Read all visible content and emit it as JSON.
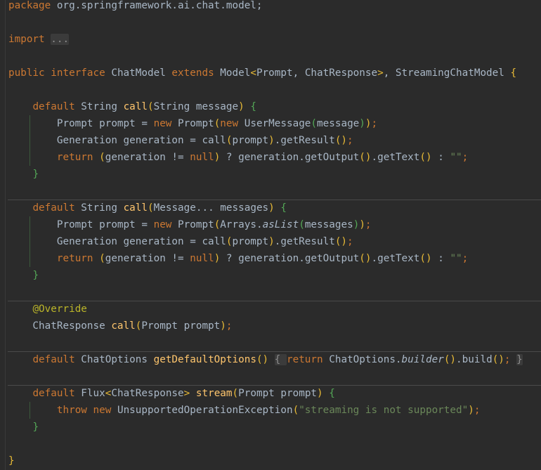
{
  "editor": {
    "theme_colors": {
      "background": "#2b2b2b",
      "keyword": "#cc7832",
      "text": "#a9b7c6",
      "method": "#ffc66d",
      "string": "#6a8759",
      "annotation": "#bbb529",
      "bracket_level1": "#e8ba36",
      "bracket_level2": "#54a857"
    }
  },
  "code": {
    "lines": [
      [
        [
          "package",
          "k"
        ],
        [
          " org.springframework.ai.chat.model;",
          ""
        ]
      ],
      [],
      [
        [
          "import",
          "k"
        ],
        [
          " ",
          ""
        ],
        [
          "...",
          "f"
        ]
      ],
      [],
      [
        [
          "public",
          "k"
        ],
        [
          " ",
          ""
        ],
        [
          "interface",
          "k"
        ],
        [
          " ChatModel ",
          ""
        ],
        [
          "extends",
          "k"
        ],
        [
          " Model",
          ""
        ],
        [
          "<",
          "p1"
        ],
        [
          "Prompt, ChatResponse",
          ""
        ],
        [
          ">",
          "p1"
        ],
        [
          ", StreamingChatModel ",
          ""
        ],
        [
          "{",
          "p1"
        ]
      ],
      [],
      [
        [
          "    ",
          ""
        ],
        [
          "default",
          "k"
        ],
        [
          " String ",
          ""
        ],
        [
          "call",
          "m"
        ],
        [
          "(",
          "p1"
        ],
        [
          "String message",
          ""
        ],
        [
          ")",
          "p1"
        ],
        [
          " ",
          ""
        ],
        [
          "{",
          "p2"
        ]
      ],
      [
        [
          "        Prompt prompt = ",
          ""
        ],
        [
          "new",
          "k"
        ],
        [
          " Prompt",
          ""
        ],
        [
          "(",
          "p1"
        ],
        [
          "new",
          "k"
        ],
        [
          " UserMessage",
          ""
        ],
        [
          "(",
          "p2"
        ],
        [
          "message",
          ""
        ],
        [
          ")",
          "p2"
        ],
        [
          ")",
          "p1"
        ],
        [
          ";",
          "k"
        ]
      ],
      [
        [
          "        Generation generation = call",
          ""
        ],
        [
          "(",
          "p1"
        ],
        [
          "prompt",
          ""
        ],
        [
          ")",
          "p1"
        ],
        [
          ".getResult",
          ""
        ],
        [
          "()",
          "p1"
        ],
        [
          ";",
          "k"
        ]
      ],
      [
        [
          "        ",
          ""
        ],
        [
          "return",
          "k"
        ],
        [
          " ",
          ""
        ],
        [
          "(",
          "p1"
        ],
        [
          "generation != ",
          ""
        ],
        [
          "null",
          "k"
        ],
        [
          ")",
          "p1"
        ],
        [
          " ? generation.getOutput",
          ""
        ],
        [
          "()",
          "p1"
        ],
        [
          ".getText",
          ""
        ],
        [
          "()",
          "p1"
        ],
        [
          " : ",
          ""
        ],
        [
          "\"\"",
          "s"
        ],
        [
          ";",
          "k"
        ]
      ],
      [
        [
          "    ",
          ""
        ],
        [
          "}",
          "p2"
        ]
      ],
      [],
      [
        [
          "    ",
          ""
        ],
        [
          "default",
          "k"
        ],
        [
          " String ",
          ""
        ],
        [
          "call",
          "m"
        ],
        [
          "(",
          "p1"
        ],
        [
          "Message... messages",
          ""
        ],
        [
          ")",
          "p1"
        ],
        [
          " ",
          ""
        ],
        [
          "{",
          "p2"
        ]
      ],
      [
        [
          "        Prompt prompt = ",
          ""
        ],
        [
          "new",
          "k"
        ],
        [
          " Prompt",
          ""
        ],
        [
          "(",
          "p1"
        ],
        [
          "Arrays.",
          ""
        ],
        [
          "asList",
          "i"
        ],
        [
          "(",
          "p2"
        ],
        [
          "messages",
          ""
        ],
        [
          ")",
          "p2"
        ],
        [
          ")",
          "p1"
        ],
        [
          ";",
          "k"
        ]
      ],
      [
        [
          "        Generation generation = call",
          ""
        ],
        [
          "(",
          "p1"
        ],
        [
          "prompt",
          ""
        ],
        [
          ")",
          "p1"
        ],
        [
          ".getResult",
          ""
        ],
        [
          "()",
          "p1"
        ],
        [
          ";",
          "k"
        ]
      ],
      [
        [
          "        ",
          ""
        ],
        [
          "return",
          "k"
        ],
        [
          " ",
          ""
        ],
        [
          "(",
          "p1"
        ],
        [
          "generation != ",
          ""
        ],
        [
          "null",
          "k"
        ],
        [
          ")",
          "p1"
        ],
        [
          " ? generation.getOutput",
          ""
        ],
        [
          "()",
          "p1"
        ],
        [
          ".getText",
          ""
        ],
        [
          "()",
          "p1"
        ],
        [
          " : ",
          ""
        ],
        [
          "\"\"",
          "s"
        ],
        [
          ";",
          "k"
        ]
      ],
      [
        [
          "    ",
          ""
        ],
        [
          "}",
          "p2"
        ]
      ],
      [],
      [
        [
          "    ",
          ""
        ],
        [
          "@Override",
          "a"
        ]
      ],
      [
        [
          "    ChatResponse ",
          ""
        ],
        [
          "call",
          "m"
        ],
        [
          "(",
          "p1"
        ],
        [
          "Prompt prompt",
          ""
        ],
        [
          ")",
          "p1"
        ],
        [
          ";",
          "k"
        ]
      ],
      [],
      [
        [
          "    ",
          ""
        ],
        [
          "default",
          "k"
        ],
        [
          " ChatOptions ",
          ""
        ],
        [
          "getDefaultOptions",
          "m"
        ],
        [
          "()",
          "p1"
        ],
        [
          " ",
          ""
        ],
        [
          "{ ",
          "f"
        ],
        [
          "return",
          "k"
        ],
        [
          " ChatOptions.",
          ""
        ],
        [
          "builder",
          "i"
        ],
        [
          "()",
          "p1"
        ],
        [
          ".build",
          ""
        ],
        [
          "()",
          "p1"
        ],
        [
          ";",
          "k"
        ],
        [
          " ",
          ""
        ],
        [
          "}",
          "f"
        ]
      ],
      [],
      [
        [
          "    ",
          ""
        ],
        [
          "default",
          "k"
        ],
        [
          " Flux",
          ""
        ],
        [
          "<",
          "p1"
        ],
        [
          "ChatResponse",
          ""
        ],
        [
          ">",
          "p1"
        ],
        [
          " ",
          ""
        ],
        [
          "stream",
          "m"
        ],
        [
          "(",
          "p1"
        ],
        [
          "Prompt prompt",
          ""
        ],
        [
          ")",
          "p1"
        ],
        [
          " ",
          ""
        ],
        [
          "{",
          "p2"
        ]
      ],
      [
        [
          "        ",
          ""
        ],
        [
          "throw",
          "k"
        ],
        [
          " ",
          ""
        ],
        [
          "new",
          "k"
        ],
        [
          " UnsupportedOperationException",
          ""
        ],
        [
          "(",
          "p1"
        ],
        [
          "\"streaming is not supported\"",
          "s"
        ],
        [
          ")",
          "p1"
        ],
        [
          ";",
          "k"
        ]
      ],
      [
        [
          "    ",
          ""
        ],
        [
          "}",
          "p2"
        ]
      ],
      [],
      [
        [
          "}",
          "p1"
        ]
      ]
    ]
  }
}
